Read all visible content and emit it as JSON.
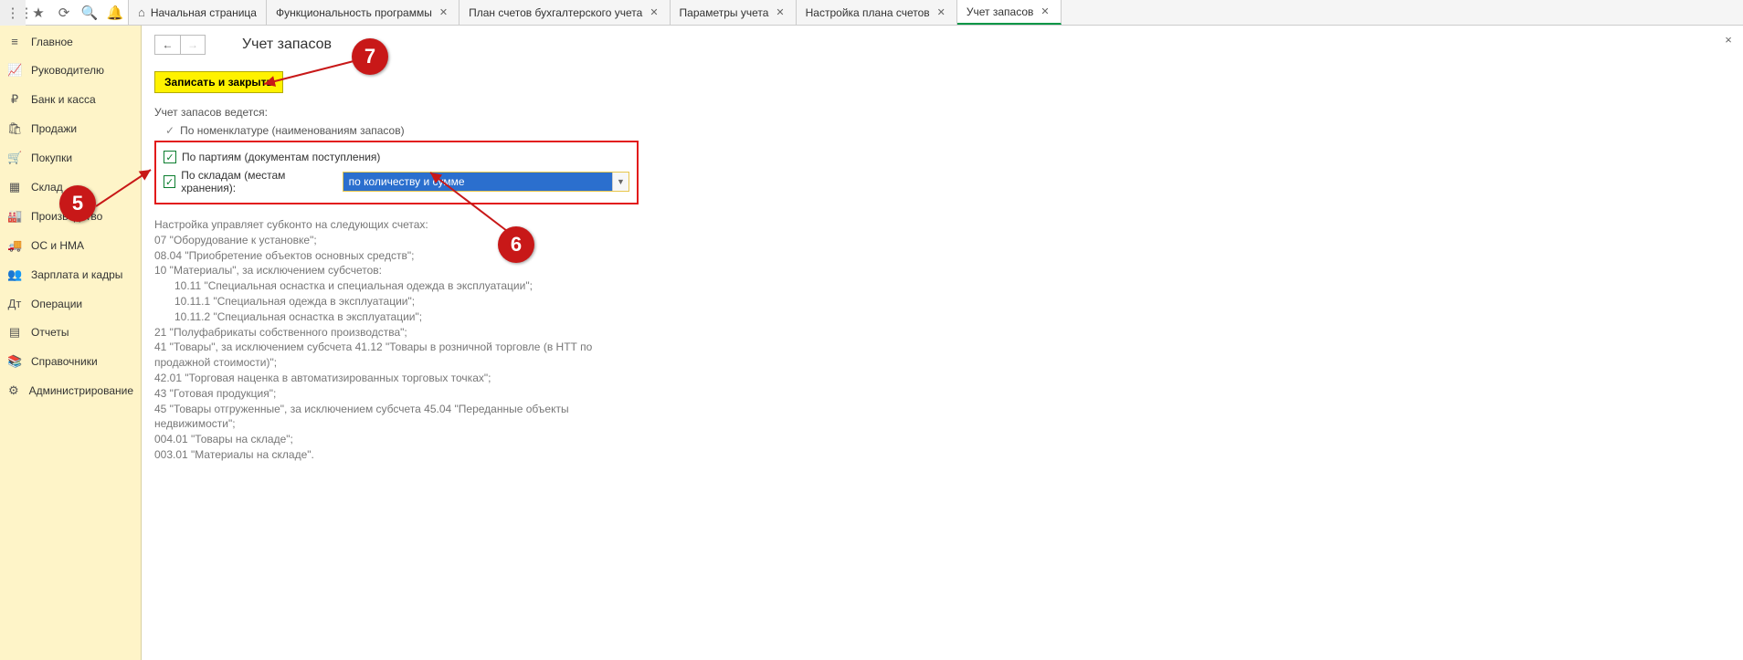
{
  "tabs": {
    "home": "Начальная страница",
    "t1": "Функциональность программы",
    "t2": "План счетов бухгалтерского учета",
    "t3": "Параметры учета",
    "t4": "Настройка плана счетов",
    "t5": "Учет запасов"
  },
  "sidebar": [
    {
      "icon": "≡",
      "label": "Главное"
    },
    {
      "icon": "📈",
      "label": "Руководителю"
    },
    {
      "icon": "₽",
      "label": "Банк и касса"
    },
    {
      "icon": "🛍",
      "label": "Продажи"
    },
    {
      "icon": "🛒",
      "label": "Покупки"
    },
    {
      "icon": "▦",
      "label": "Склад"
    },
    {
      "icon": "🏭",
      "label": "Производство"
    },
    {
      "icon": "🚚",
      "label": "ОС и НМА"
    },
    {
      "icon": "👥",
      "label": "Зарплата и кадры"
    },
    {
      "icon": "Дт",
      "label": "Операции"
    },
    {
      "icon": "▤",
      "label": "Отчеты"
    },
    {
      "icon": "📚",
      "label": "Справочники"
    },
    {
      "icon": "⚙",
      "label": "Администрирование"
    }
  ],
  "page": {
    "title": "Учет запасов",
    "save_close": "Записать и закрыть",
    "intro": "Учет запасов ведется:",
    "readonly_line": "По номенклатуре (наименованиям запасов)",
    "chk_party": "По партиям (документам поступления)",
    "chk_sklad": "По складам (местам хранения):",
    "dropdown_value": "по количеству и сумме"
  },
  "info_lines": [
    "Настройка управляет субконто на следующих счетах:",
    "07 \"Оборудование к установке\";",
    "08.04 \"Приобретение объектов основных средств\";",
    "10 \"Материалы\", за исключением субсчетов:",
    "10.11 \"Специальная оснастка и специальная одежда в эксплуатации\";",
    "10.11.1 \"Специальная одежда в эксплуатации\";",
    "10.11.2 \"Специальная оснастка в эксплуатации\";",
    "21 \"Полуфабрикаты собственного производства\";",
    "41 \"Товары\", за исключением субсчета 41.12 \"Товары в розничной торговле (в НТТ по продажной стоимости)\";",
    "42.01 \"Торговая наценка в автоматизированных торговых точках\";",
    "43 \"Готовая продукция\";",
    "45 \"Товары отгруженные\", за исключением субсчета 45.04 \"Переданные объекты недвижимости\";",
    "004.01 \"Товары на складе\";",
    "003.01 \"Материалы на складе\"."
  ],
  "info_indent_idx": [
    4,
    5,
    6
  ],
  "callouts": {
    "c5": "5",
    "c6": "6",
    "c7": "7"
  }
}
